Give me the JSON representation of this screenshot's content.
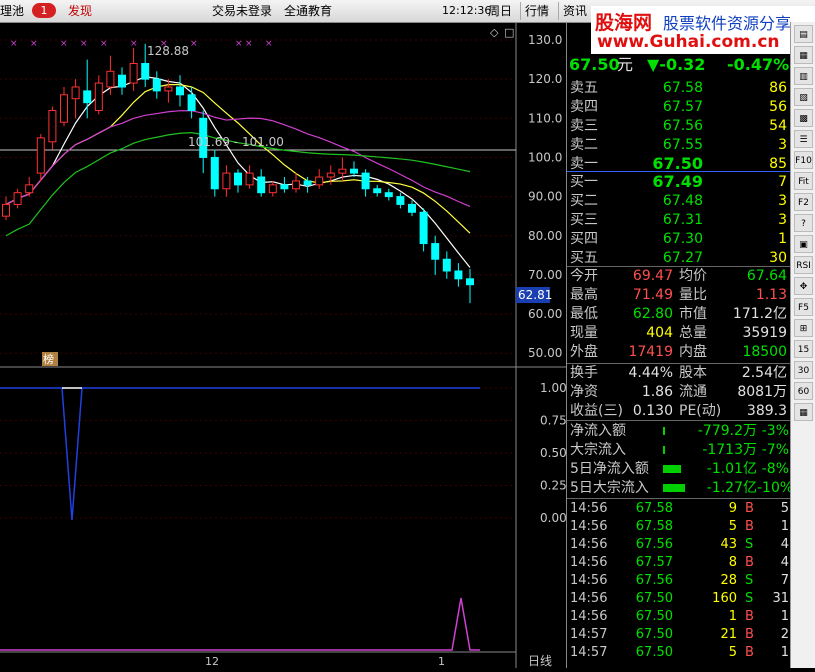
{
  "topbar": {
    "left_label": "理池",
    "badge": "1",
    "discover": "发现",
    "login_status": "交易未登录",
    "edu": "全通教育",
    "time": "12:12:36",
    "weekday": "周日",
    "quote_btn": "行情",
    "info_btn": "资讯"
  },
  "logo": {
    "cn": "股海网",
    "slogan": "股票软件资源分享",
    "url": "www.Guhai.com.cn"
  },
  "chart": {
    "price_axis": [
      "130.0",
      "120.0",
      "110.0",
      "100.0",
      "90.00",
      "80.00",
      "70.00",
      "60.00",
      "50.00"
    ],
    "high_label": "128.88",
    "range_label": "101.69 - 101.00",
    "current_price": "62.81",
    "marker_label": "榜",
    "ind_axis": [
      "1.00",
      "0.75",
      "0.50",
      "0.25",
      "0.00"
    ],
    "x_labels": [
      "12",
      "1"
    ],
    "period": "日线"
  },
  "quote": {
    "price": "67.50",
    "unit": "元",
    "change": "▼-0.32",
    "pct": "-0.47%"
  },
  "asks": [
    {
      "label": "卖五",
      "price": "67.58",
      "vol": "86"
    },
    {
      "label": "卖四",
      "price": "67.57",
      "vol": "56"
    },
    {
      "label": "卖三",
      "price": "67.56",
      "vol": "54"
    },
    {
      "label": "卖二",
      "price": "67.55",
      "vol": "3"
    },
    {
      "label": "卖一",
      "price": "67.50",
      "vol": "85"
    }
  ],
  "bids": [
    {
      "label": "买一",
      "price": "67.49",
      "vol": "7"
    },
    {
      "label": "买二",
      "price": "67.48",
      "vol": "3"
    },
    {
      "label": "买三",
      "price": "67.31",
      "vol": "3"
    },
    {
      "label": "买四",
      "price": "67.30",
      "vol": "1"
    },
    {
      "label": "买五",
      "price": "67.27",
      "vol": "30"
    }
  ],
  "stats": [
    {
      "l1": "今开",
      "v1": "69.47",
      "l2": "均价",
      "v2": "67.64"
    },
    {
      "l1": "最高",
      "v1": "71.49",
      "l2": "量比",
      "v2": "1.13"
    },
    {
      "l1": "最低",
      "v1": "62.80",
      "l2": "市值",
      "v2": "171.2亿"
    },
    {
      "l1": "现量",
      "v1": "404",
      "l2": "总量",
      "v2": "35919"
    },
    {
      "l1": "外盘",
      "v1": "17419",
      "l2": "内盘",
      "v2": "18500"
    }
  ],
  "stats2": [
    {
      "l1": "换手",
      "v1": "4.44%",
      "l2": "股本",
      "v2": "2.54亿"
    },
    {
      "l1": "净资",
      "v1": "1.86",
      "l2": "流通",
      "v2": "8081万"
    },
    {
      "l1": "收益(三)",
      "v1": "0.130",
      "l2": "PE(动)",
      "v2": "389.3"
    }
  ],
  "flows": [
    {
      "label": "净流入额",
      "val": "-779.2万",
      "pct": "-3%",
      "bar": 0.03
    },
    {
      "label": "大宗流入",
      "val": "-1713万",
      "pct": "-7%",
      "bar": 0.07
    },
    {
      "label": "5日净流入额",
      "val": "-1.01亿",
      "pct": "-8%",
      "bar": 0.8
    },
    {
      "label": "5日大宗流入",
      "val": "-1.27亿",
      "pct": "-10%",
      "bar": 1.0
    }
  ],
  "ticks": [
    {
      "t": "14:56",
      "p": "67.58",
      "v": "9",
      "s": "B",
      "n": "5"
    },
    {
      "t": "14:56",
      "p": "67.58",
      "v": "5",
      "s": "B",
      "n": "1"
    },
    {
      "t": "14:56",
      "p": "67.56",
      "v": "43",
      "s": "S",
      "n": "4"
    },
    {
      "t": "14:56",
      "p": "67.57",
      "v": "8",
      "s": "B",
      "n": "4"
    },
    {
      "t": "14:56",
      "p": "67.56",
      "v": "28",
      "s": "S",
      "n": "7"
    },
    {
      "t": "14:56",
      "p": "67.50",
      "v": "160",
      "s": "S",
      "n": "31"
    },
    {
      "t": "14:56",
      "p": "67.50",
      "v": "1",
      "s": "B",
      "n": "1"
    },
    {
      "t": "14:57",
      "p": "67.50",
      "v": "21",
      "s": "B",
      "n": "2"
    },
    {
      "t": "14:57",
      "p": "67.50",
      "v": "5",
      "s": "B",
      "n": "1"
    }
  ],
  "sidebar": [
    "▤",
    "▦",
    "▥",
    "▧",
    "▩",
    "☰",
    "F10",
    "Fit",
    "F2",
    "?",
    "▣",
    "RSI",
    "✥",
    "F5",
    "⊞",
    "15",
    "30",
    "60",
    "▦"
  ]
}
